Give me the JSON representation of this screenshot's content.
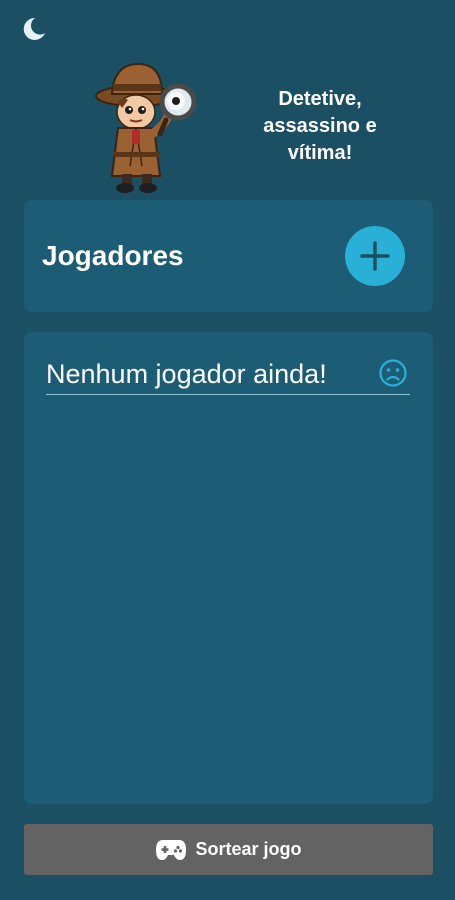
{
  "header": {
    "theme_icon": "moon-icon",
    "mascot": "detective-illustration",
    "tagline_lines": [
      "Detetive,",
      "assassino e",
      "vítima!"
    ]
  },
  "players": {
    "title": "Jogadores",
    "add_icon": "plus-icon",
    "empty_message": "Nenhum jogador ainda!",
    "empty_icon": "sad-face-icon"
  },
  "footer": {
    "draw_button_label": "Sortear jogo",
    "draw_button_icon": "gamepad-icon"
  },
  "colors": {
    "background": "#1b4f63",
    "card": "#1d5c75",
    "accent": "#29b0d6",
    "button": "#636363"
  }
}
